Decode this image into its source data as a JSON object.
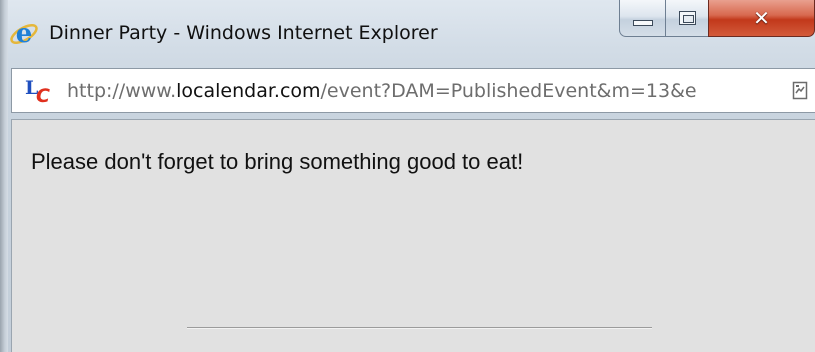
{
  "window": {
    "title": "Dinner Party - Windows Internet Explorer",
    "app_icon": "internet-explorer-icon",
    "buttons": {
      "minimize": "minimize-icon",
      "maximize": "maximize-icon",
      "close": "close-icon"
    }
  },
  "address_bar": {
    "site_icon": "localendar-icon",
    "url_prefix": "http://www.",
    "url_domain": "localendar.com",
    "url_path": "/event?DAM=PublishedEvent&m=13&e",
    "compat_icon": "compatibility-view-icon"
  },
  "content": {
    "message": "Please don't forget to bring something good to eat!"
  },
  "colors": {
    "close_button": "#c2391b",
    "content_background": "#e1e1e1",
    "ie_blue": "#1e7fd6",
    "localendar_blue": "#1f4fbf",
    "localendar_red": "#e0301e"
  }
}
